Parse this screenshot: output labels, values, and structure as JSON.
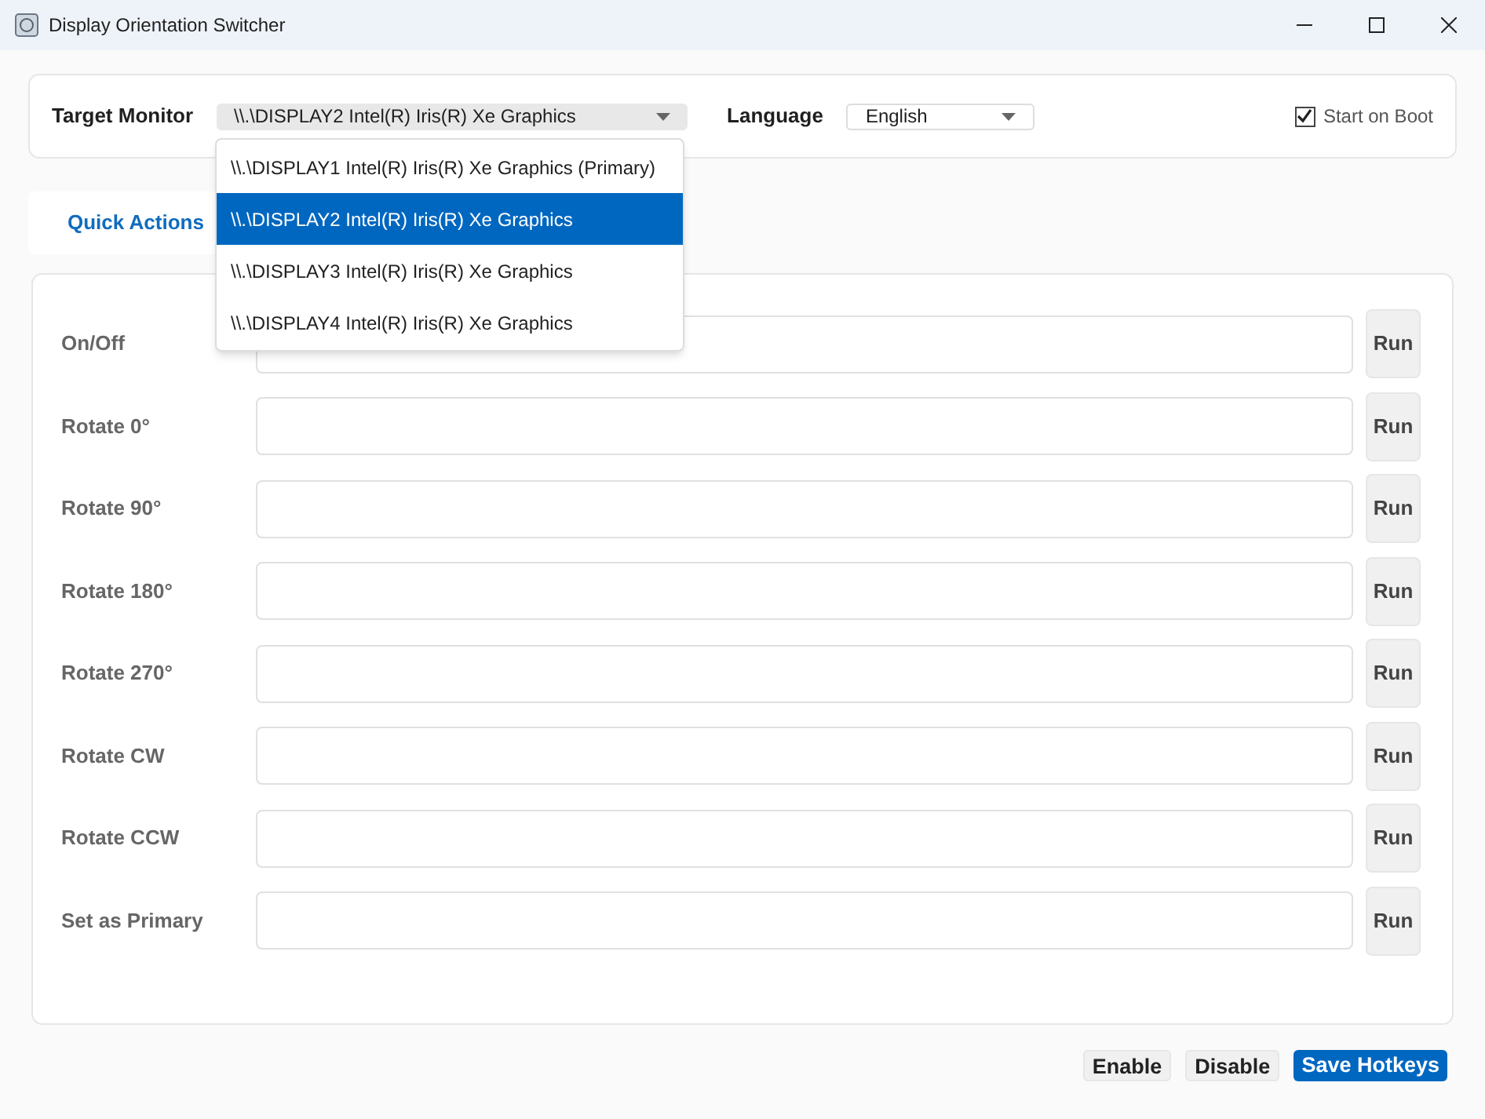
{
  "window": {
    "title": "Display Orientation Switcher"
  },
  "settings": {
    "monitor_label": "Target Monitor",
    "monitor_value": "\\\\.\\DISPLAY2 Intel(R) Iris(R) Xe Graphics",
    "language_label": "Language",
    "language_value": "English",
    "start_on_boot": {
      "label": "Start on Boot",
      "checked": true
    }
  },
  "monitor_options": [
    {
      "label": "\\\\.\\DISPLAY1 Intel(R) Iris(R) Xe Graphics (Primary)",
      "selected": false
    },
    {
      "label": "\\\\.\\DISPLAY2 Intel(R) Iris(R) Xe Graphics",
      "selected": true
    },
    {
      "label": "\\\\.\\DISPLAY3 Intel(R) Iris(R) Xe Graphics",
      "selected": false
    },
    {
      "label": "\\\\.\\DISPLAY4 Intel(R) Iris(R) Xe Graphics",
      "selected": false
    }
  ],
  "tabs": [
    {
      "label": "Quick Actions",
      "selected": true
    }
  ],
  "actions": [
    {
      "label": "On/Off",
      "button": "Run"
    },
    {
      "label": "Rotate 0°",
      "button": "Run"
    },
    {
      "label": "Rotate 90°",
      "button": "Run"
    },
    {
      "label": "Rotate 180°",
      "button": "Run"
    },
    {
      "label": "Rotate 270°",
      "button": "Run"
    },
    {
      "label": "Rotate CW",
      "button": "Run"
    },
    {
      "label": "Rotate CCW",
      "button": "Run"
    },
    {
      "label": "Set as Primary",
      "button": "Run"
    }
  ],
  "footer_buttons": [
    {
      "label": "Enable",
      "kind": "secondary"
    },
    {
      "label": "Disable",
      "kind": "secondary"
    },
    {
      "label": "Save Hotkeys",
      "kind": "primary"
    }
  ]
}
